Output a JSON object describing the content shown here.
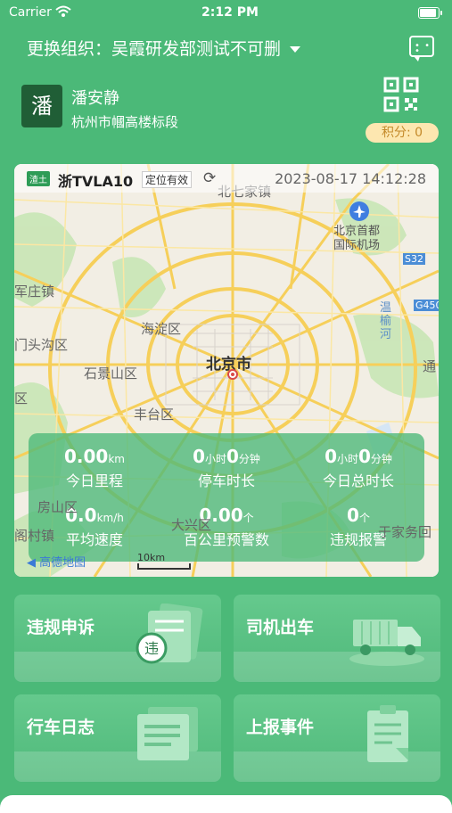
{
  "status_bar": {
    "carrier": "Carrier",
    "time": "2:12 PM"
  },
  "header": {
    "org_label": "更换组织：吴霞研发部测试不可删"
  },
  "user": {
    "avatar_char": "潘",
    "name": "潘安静",
    "unit": "杭州市幗高楼标段",
    "points": "积分: 0"
  },
  "map": {
    "plate_tag": "渣土",
    "plate": "浙TVLA10",
    "loc_status": "定位有效",
    "datetime": "2023-08-17 14:12:28",
    "labels": {
      "beiqijiazhen": "北七家镇",
      "airport": "北京首都\n国际机场",
      "s32": "S32",
      "g45": "G450",
      "wenyu": "温\n榆\n河",
      "junzhuang": "军庄镇",
      "mentougou": "门头沟区",
      "haidian": "海淀区",
      "beijing": "北京市",
      "shijingshan": "石景山区",
      "fengtai": "丰台区",
      "tongzhou": "通",
      "fangshan": "房山区",
      "daxing": "大兴区",
      "yujiawu": "于家务回",
      "wangcun": "阁村镇",
      "ta": "区",
      "amap": "高德地图",
      "scale": "10km"
    }
  },
  "stats": [
    {
      "value": "0.00",
      "unit": "km",
      "label": "今日里程"
    },
    {
      "value": "0",
      "unit": "小时",
      "value2": "0",
      "unit2": "分钟",
      "label": "停车时长"
    },
    {
      "value": "0",
      "unit": "小时",
      "value2": "0",
      "unit2": "分钟",
      "label": "今日总时长"
    },
    {
      "value": "0.0",
      "unit": "km/h",
      "label": "平均速度"
    },
    {
      "value": "0.00",
      "unit": "个",
      "label": "百公里预警数"
    },
    {
      "value": "0",
      "unit": "个",
      "label": "违规报警"
    }
  ],
  "cards": [
    {
      "title": "违规申诉",
      "icon": "appeal-icon",
      "glyph": "违"
    },
    {
      "title": "司机出车",
      "icon": "truck-icon"
    },
    {
      "title": "行车日志",
      "icon": "log-icon"
    },
    {
      "title": "上报事件",
      "icon": "report-icon"
    }
  ],
  "colors": {
    "primary": "#4bb978",
    "points_bg": "#fde7b0",
    "points_text": "#c48a2a"
  }
}
